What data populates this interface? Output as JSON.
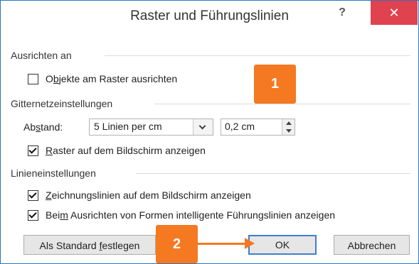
{
  "dialog": {
    "title": "Raster und Führungslinien",
    "help_label": "?",
    "close_label": "✕"
  },
  "sections": {
    "snap": "Ausrichten an",
    "grid": "Gitternetzeinstellungen",
    "guides": "Linieneinstellungen"
  },
  "options": {
    "snap_objects": {
      "pre": "O",
      "ul": "b",
      "post": "jekte am Raster ausrichten",
      "checked": false
    },
    "spacing_label": {
      "pre": "Ab",
      "ul": "s",
      "post": "tand:"
    },
    "spacing_select": "5 Linien per cm",
    "spacing_value": "0,2  cm",
    "show_grid": {
      "pre": "",
      "ul": "R",
      "post": "aster auf dem Bildschirm anzeigen",
      "checked": true
    },
    "show_drawing_guides": {
      "pre": "",
      "ul": "Z",
      "post": "eichnungslinien auf dem Bildschirm anzeigen",
      "checked": true
    },
    "smart_guides": {
      "pre": "Bei",
      "ul": "m",
      "post": " Ausrichten von Formen intelligente Führungslinien anzeigen",
      "checked": true
    }
  },
  "buttons": {
    "set_default": {
      "pre": "Als Standard ",
      "ul": "f",
      "post": "estlegen"
    },
    "ok": "OK",
    "cancel": "Abbrechen"
  },
  "annotations": {
    "badge1": "1",
    "badge2": "2",
    "color": "#f47920"
  },
  "colors": {
    "close_button": "#e0424f",
    "border": "#2b76c0",
    "default_button_border": "#3c7fd0"
  }
}
